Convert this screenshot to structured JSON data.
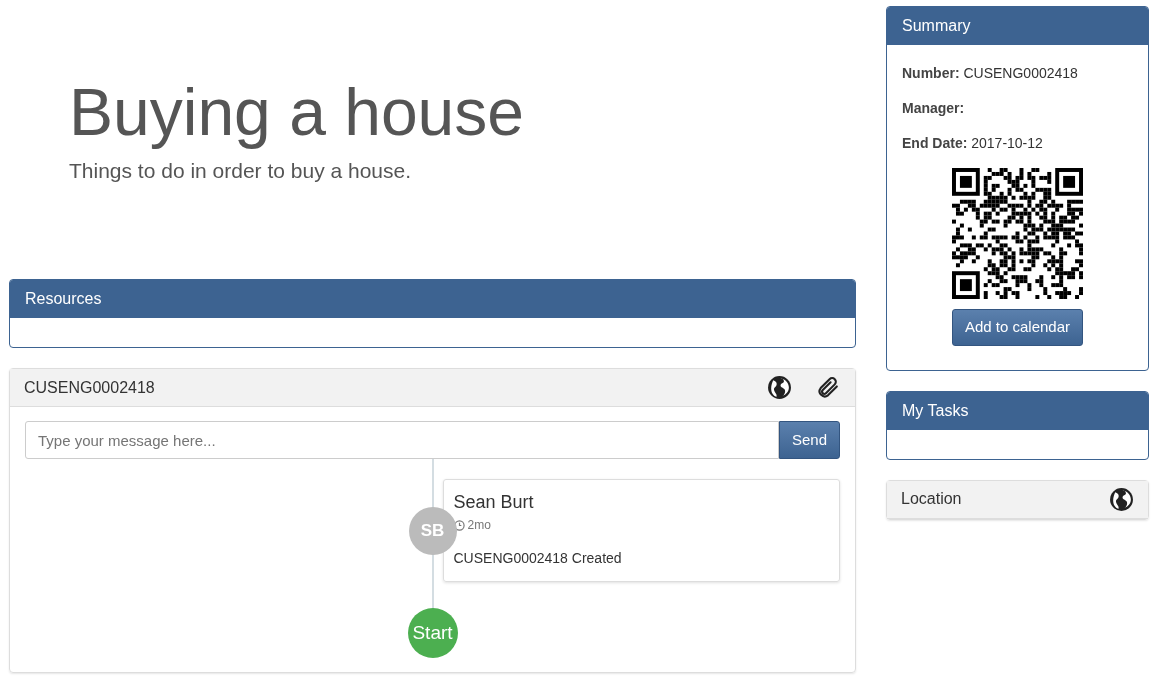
{
  "hero": {
    "title": "Buying a house",
    "subtitle": "Things to do in order to buy a house."
  },
  "resources": {
    "title": "Resources"
  },
  "conversation": {
    "title": "CUSENG0002418",
    "message": {
      "placeholder": "Type your message here..."
    },
    "send_button": "Send",
    "timeline": [
      {
        "kind": "entry",
        "initials": "SB",
        "author": "Sean Burt",
        "time": "2mo",
        "text": "CUSENG0002418 Created"
      },
      {
        "kind": "start",
        "label": "Start"
      }
    ]
  },
  "summary": {
    "title": "Summary",
    "fields": [
      {
        "label": "Number:",
        "value": "CUSENG0002418"
      },
      {
        "label": "Manager:"
      },
      {
        "label": "End Date:",
        "value": "2017-10-12"
      }
    ],
    "button": "Add to calendar"
  },
  "my_tasks": {
    "title": "My Tasks"
  },
  "location": {
    "title": "Location"
  }
}
